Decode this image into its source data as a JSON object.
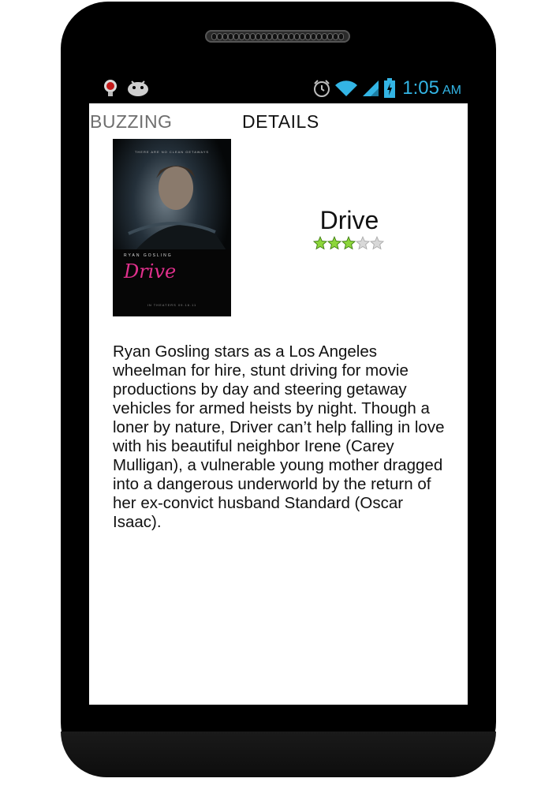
{
  "status_bar": {
    "time": "1:05",
    "ampm": "AM",
    "icons": [
      "notification-icon",
      "android-icon",
      "alarm-icon",
      "wifi-icon",
      "signal-icon",
      "battery-icon"
    ]
  },
  "tabs": [
    {
      "label": "BUZZING"
    },
    {
      "label": "DETAILS"
    }
  ],
  "movie": {
    "title": "Drive",
    "rating": 3,
    "rating_max": 5,
    "poster": {
      "tagline": "THERE ARE NO CLEAN GETAWAYS",
      "actor": "RYAN GOSLING",
      "title": "Drive",
      "footer": "IN THEATERS 09.16.11"
    },
    "synopsis": "Ryan Gosling stars as a Los Angeles wheelman for hire, stunt driving for movie productions by day and steering getaway vehicles for armed heists by night. Though a loner by nature, Driver can’t help falling in love with his beautiful neighbor Irene (Carey Mulligan), a vulnerable young mother dragged into a dangerous underworld by the return of her ex-convict husband Standard (Oscar Isaac)."
  },
  "colors": {
    "clock": "#33b5e5",
    "star_filled": "#8cd63a",
    "star_empty": "#d8d8d8",
    "poster_title": "#e0308c"
  }
}
